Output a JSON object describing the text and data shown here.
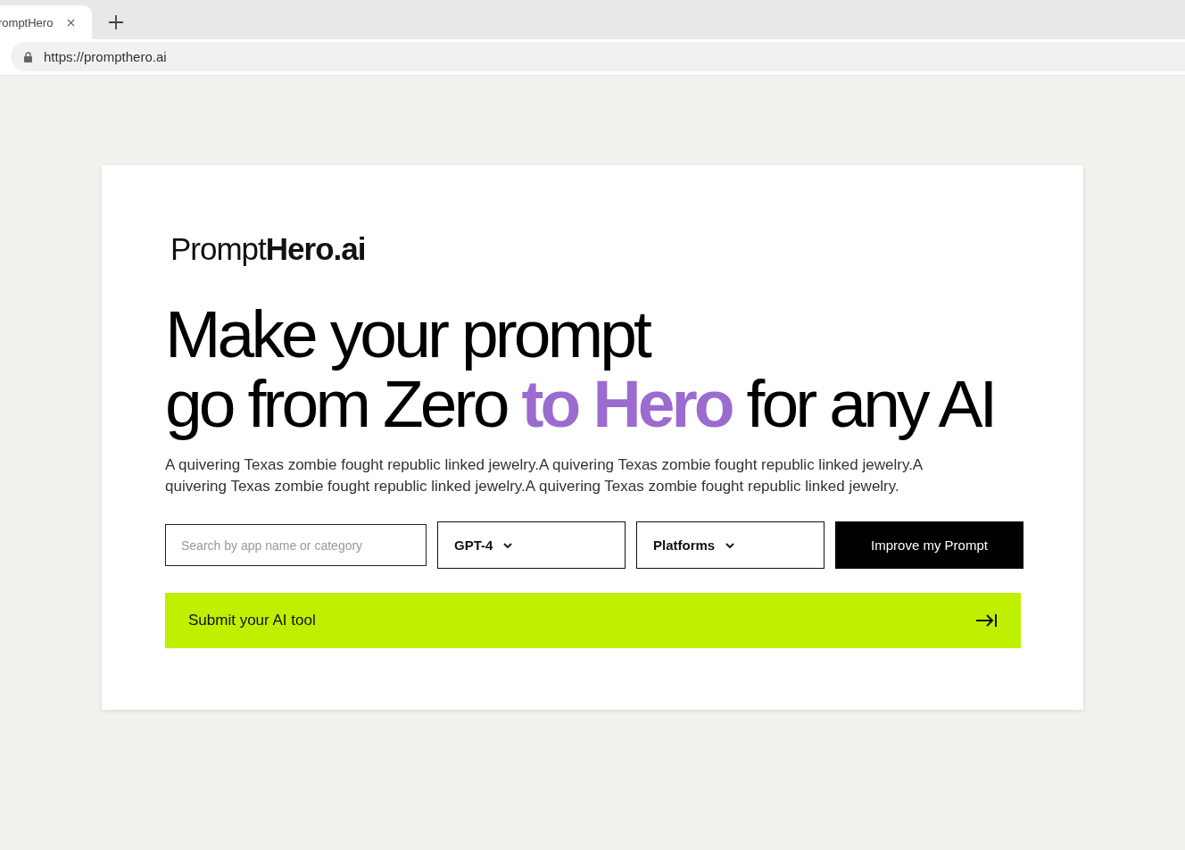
{
  "browser": {
    "tab": {
      "title": "romptHero"
    },
    "url": "https://prompthero.ai"
  },
  "logo": "Prompt**Hero.ai**",
  "headline": {
    "lines": [
      [
        {
          "text": "Make your prompt",
          "highlighted": false
        }
      ],
      [
        {
          "text": "go from Zero ",
          "highlighted": false
        },
        {
          "text": "to Hero",
          "highlighted": true
        },
        {
          "text": " for any AI",
          "highlighted": false
        }
      ]
    ]
  },
  "description": "A quivering Texas zombie fought republic linked jewelry.A quivering Texas zombie fought republic linked jewelry.A quivering Texas zombie fought republic linked jewelry.A quivering Texas zombie fought republic linked jewelry.",
  "search": {
    "placeholder": "Search by app name or category"
  },
  "dropdowns": [
    {
      "label": "GPT-4"
    },
    {
      "label": "Platforms"
    }
  ],
  "improve_button": {
    "label": "Improve my Prompt"
  },
  "submit_bar": {
    "label": "Submit your AI tool"
  }
}
